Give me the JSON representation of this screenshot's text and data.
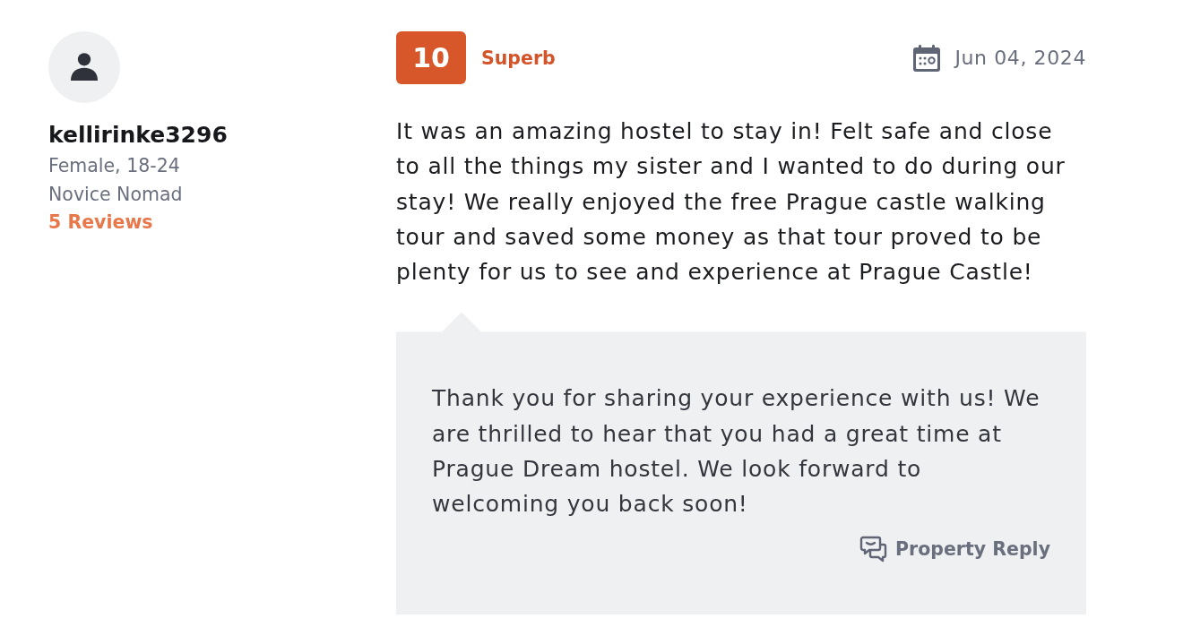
{
  "reviewer": {
    "username": "kellirinke3296",
    "details": [
      "Female, 18-24",
      "Novice Nomad"
    ],
    "review_count": "5 Reviews"
  },
  "review": {
    "score": "10",
    "rating_label": "Superb",
    "date": "Jun 04, 2024",
    "text": "It was an amazing hostel to stay in! Felt safe and close to all the things my sister and I wanted to do during our stay! We really enjoyed the free Prague castle walking tour and saved some money as that tour proved to be plenty for us to see and experience at Prague Castle!"
  },
  "property_reply": {
    "text": "Thank you for sharing your experience with us! We are thrilled to hear that you had a great time at Prague Dream hostel. We look forward to welcoming you back soon!",
    "label": "Property Reply"
  }
}
